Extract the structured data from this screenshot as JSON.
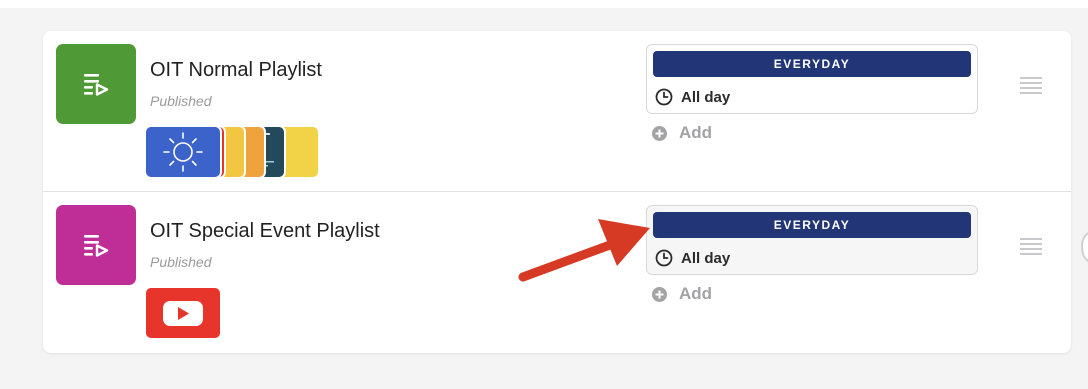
{
  "playlists": [
    {
      "title": "OIT Normal Playlist",
      "status": "Published",
      "icon": "playlist-play-icon",
      "icon_color": "#4f9a36",
      "schedule": {
        "day_label": "EVERYDAY",
        "time_label": "All day"
      },
      "add_label": "Add"
    },
    {
      "title": "OIT Special Event Playlist",
      "status": "Published",
      "icon": "playlist-play-icon",
      "icon_color": "#bf2e96",
      "schedule": {
        "day_label": "EVERYDAY",
        "time_label": "All day"
      },
      "add_label": "Add"
    }
  ],
  "colors": {
    "badge": "#213577",
    "arrow": "#d63a24",
    "youtube": "#e8352b",
    "weather": "#3b63c9"
  }
}
